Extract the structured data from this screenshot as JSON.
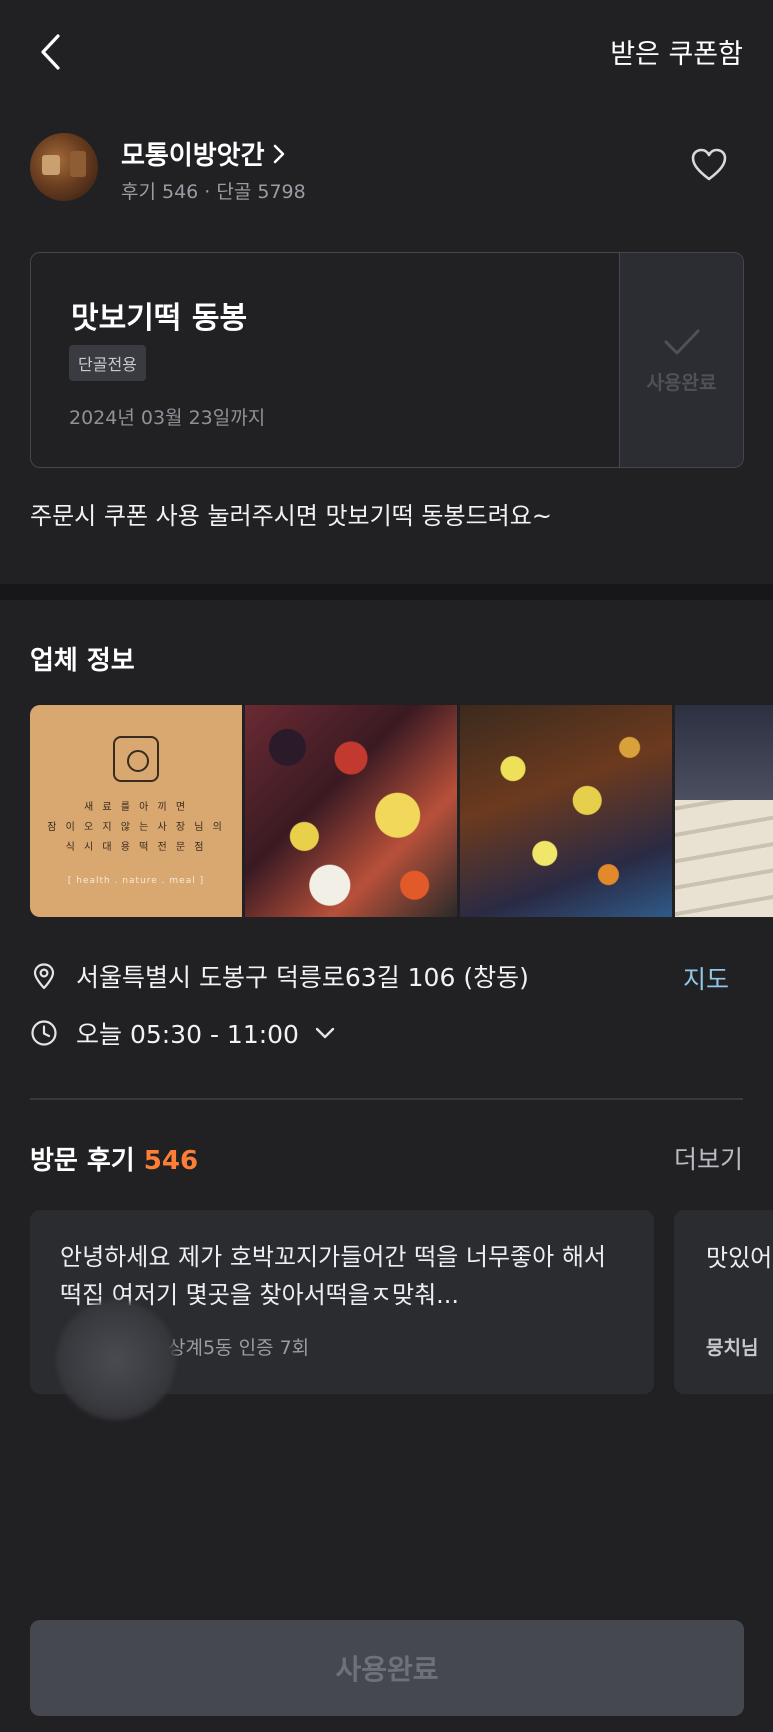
{
  "header": {
    "back_icon": "chevron-left-icon",
    "right_link": "받은 쿠폰함"
  },
  "store": {
    "name": "모통이방앗간",
    "meta": "후기 546 · 단골 5798",
    "favorite_icon": "heart-outline-icon"
  },
  "coupon": {
    "title": "맛보기떡 동봉",
    "badge": "단골전용",
    "expiry": "2024년 03월 23일까지",
    "status": "사용완료",
    "description": "주문시 쿠폰 사용 눌러주시면 맛보기떡 동봉드려요~"
  },
  "business_info": {
    "title": "업체 정보",
    "logo_text": [
      "새 료 를 아 끼 면",
      "잠 이 오 지 않 는 사 장 님 의",
      "식 시 대 용 떡 전 문 점"
    ],
    "logo_sub": "[ health . nature . meal ]",
    "address": "서울특별시 도봉구 덕릉로63길 106 (창동)",
    "map_label": "지도",
    "hours": "오늘 05:30 - 11:00"
  },
  "reviews": {
    "title": "방문 후기",
    "count": "546",
    "more_label": "더보기",
    "items": [
      {
        "text": "안녕하세요 제가 호박꼬지가들어간 떡을 너무좋아 해서 떡집 여저기 몇곳을 찾아서떡을ㅈ맞춰...",
        "meta": "상계5동 인증 7회"
      },
      {
        "text": "맛있어",
        "meta": "뭉치님"
      }
    ]
  },
  "bottom_button": "사용완료",
  "colors": {
    "background": "#212124",
    "accent": "#ff7e36",
    "link": "#8fc7e8"
  }
}
